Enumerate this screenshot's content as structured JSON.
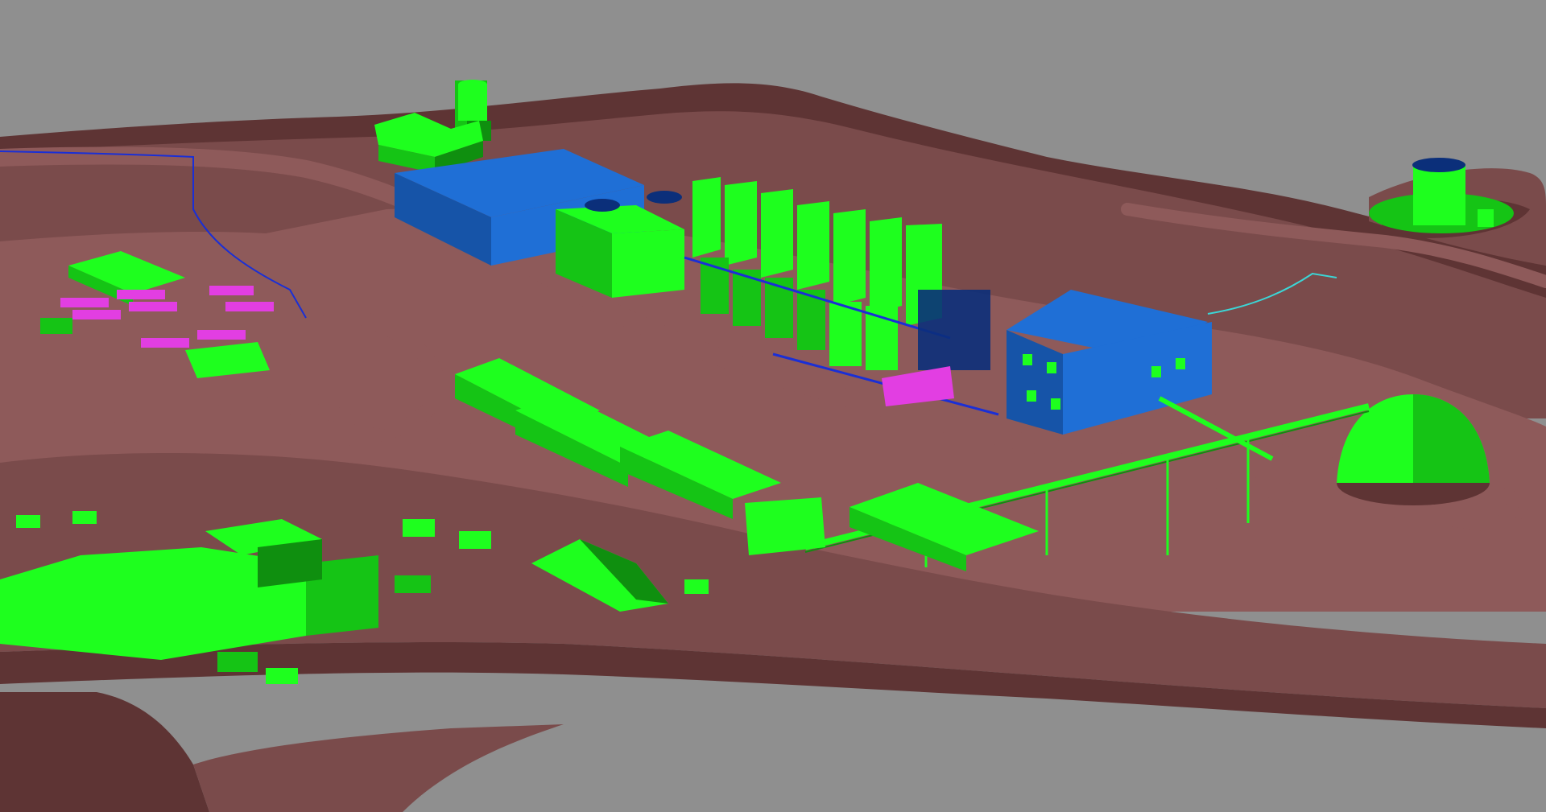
{
  "scene": {
    "kind": "3d-plant-model-render",
    "colors": {
      "background": "#8f8f8f",
      "terrain_main": "#7a4b4b",
      "terrain_light": "#8e5a5a",
      "terrain_dark": "#5e3434",
      "terrain_shadow": "#4f2b2b",
      "equipment_green": "#1eff1e",
      "green_shade": "#15c415",
      "green_dark": "#0f8f0f",
      "building_blue": "#1f6fd6",
      "blue_shade": "#1654a8",
      "blue_dark": "#0b2f7a",
      "magenta": "#e23ee2",
      "magenta_shade": "#b02ab0",
      "pipe_blue": "#1a2fd6",
      "cyan_pipe": "#3bd6d6"
    },
    "objects": [
      "mill-building",
      "processing-building",
      "leach-tank-row",
      "thickener-tank",
      "stockpile-dome",
      "overland-conveyor",
      "workshop-sheds",
      "warehouse-block",
      "modular-offices",
      "haul-trucks",
      "ore-pad",
      "haul-roads",
      "terrain-benches"
    ]
  }
}
